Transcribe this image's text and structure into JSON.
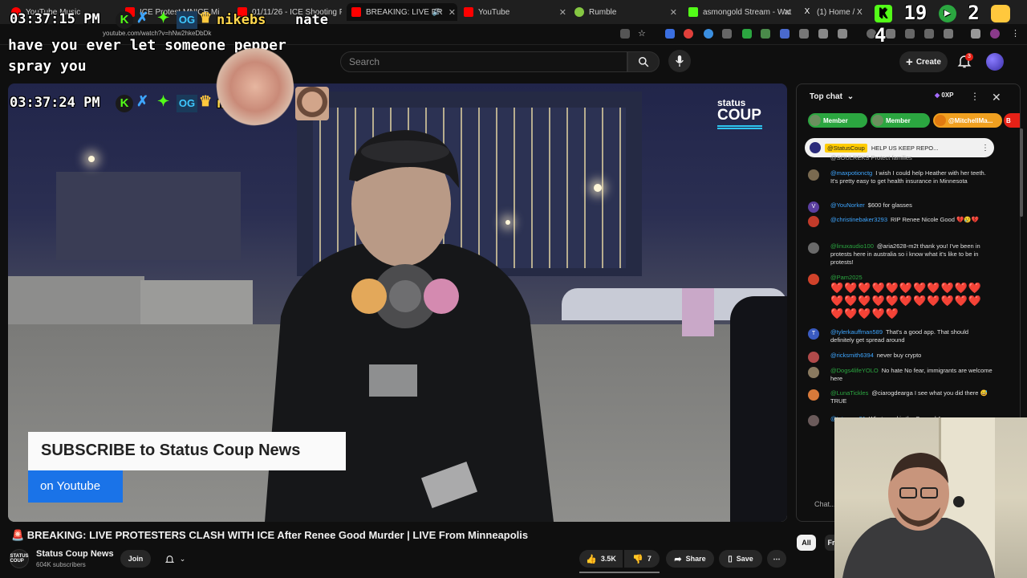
{
  "browser": {
    "tabs": [
      {
        "label": "YouTube Music",
        "color": "#ff0000"
      },
      {
        "label": "ICE Protest MNICE Mi",
        "color": "#ff0000"
      },
      {
        "label": "01/11/26 - ICE Shooting F",
        "color": "#ff0000"
      },
      {
        "label": "BREAKING: LIVE PR",
        "color": "#ff0000"
      },
      {
        "label": "YouTube",
        "color": "#ff0000"
      },
      {
        "label": "Rumble",
        "color": "#85c742"
      },
      {
        "label": "asmongold Stream - Wat",
        "color": "#53fc18"
      },
      {
        "label": "(1) Home / X",
        "color": "#ffffff"
      }
    ],
    "url": "youtube.com/watch?v=hNw2hkeDbDk"
  },
  "overlay": {
    "clock_top": "03:37:15 PM",
    "clock_bottom": "03:37:24 PM",
    "user_top": "nikebs",
    "user_top_extra": "nate",
    "user_bottom": "nikebs",
    "tts_message": "have you ever let someone pepper spray you",
    "counter_a": "19",
    "counter_b": "2",
    "counter_c": "4"
  },
  "youtube": {
    "search_placeholder": "Search",
    "create_label": "Create",
    "notification_count": "3"
  },
  "video": {
    "title": "🚨 BREAKING: LIVE PROTESTERS CLASH WITH ICE After Renee Good Murder | LIVE From Minneapolis",
    "subscribe_banner": "SUBSCRIBE to Status Coup News",
    "youtube_banner": "on Youtube",
    "watermark_line1": "status",
    "watermark_line2": "COUP",
    "channel_avatar_text": "STATUS COUP",
    "channel_name": "Status Coup News",
    "channel_subscribers": "604K subscribers",
    "join_label": "Join",
    "likes": "3.5K",
    "dislikes": "7",
    "share_label": "Share",
    "save_label": "Save"
  },
  "chat": {
    "header": "Top chat",
    "xp_badge": "0XP",
    "chips": [
      "Member",
      "Member",
      "@MitchellMa...",
      "B"
    ],
    "pinned_user": "@StatusCoup",
    "pinned_text": "HELP US KEEP REPO...",
    "truncated_top": "@SOULREKS  Protect families",
    "messages": [
      {
        "user": "@maxpotionctg",
        "text": "I wish I could help Heather with her teeth. It's pretty easy to get health insurance in Minnesota",
        "avatar": "#7a6a50"
      },
      {
        "user": "@YouNorker",
        "text": "$600 for glasses",
        "avatar": "#5b3fa0",
        "letter": "V"
      },
      {
        "user": "@christinebaker3293",
        "text": "RIP Renee Nicole Good 💔😢💔",
        "avatar": "#c23b2a"
      },
      {
        "user": "@linuxaudio100",
        "text": "@aria2628-m2t thank you! I've been in protests here in australia so i know what it's like to be in protests!",
        "avatar": "#6a6a6a"
      },
      {
        "user": "@Pam2025",
        "text": "❤️❤️❤️❤️❤️❤️❤️❤️❤️❤️❤️❤️❤️❤️❤️❤️❤️❤️❤️❤️❤️❤️❤️❤️❤️❤️❤️",
        "avatar": "#d0422a"
      },
      {
        "user": "@tylerkauffman589",
        "text": "That's a good app. That should definitely get spread around",
        "avatar": "#3a5bc0",
        "letter": "T"
      },
      {
        "user": "@ricksmith6394",
        "text": "never buy crypto",
        "avatar": "#b04a4a"
      },
      {
        "user": "@Dogs4lifeYOLO",
        "text": "No hate No fear, immigrants are welcome here",
        "avatar": "#8a7a60"
      },
      {
        "user": "@LunaTickles",
        "text": "@ciarogdearga I see what you did there 😅 TRUE",
        "avatar": "#d87a3a"
      },
      {
        "user": "@tetzwom81",
        "text": "What good is the Second Am...",
        "avatar": "#6a5a5a"
      }
    ],
    "input_placeholder": "Chat...",
    "filter_all": "All",
    "filter_fr": "Fr"
  }
}
